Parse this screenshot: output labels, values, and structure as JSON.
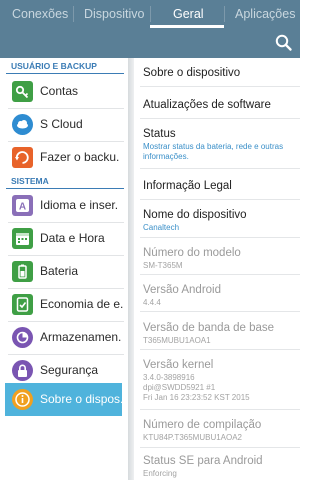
{
  "tabs": [
    "Conexões",
    "Dispositivo",
    "Geral",
    "Aplicações"
  ],
  "active_tab": "Geral",
  "sidebar": {
    "sections": [
      {
        "title": "USUÁRIO E BACKUP",
        "items": [
          {
            "label": "Contas",
            "icon": "key-icon",
            "color": "#3f9f45"
          },
          {
            "label": "S Cloud",
            "icon": "cloud-icon",
            "color": "#2e8cd1"
          },
          {
            "label": "Fazer o backu.",
            "icon": "backup-icon",
            "color": "#e8632a"
          }
        ]
      },
      {
        "title": "SISTEMA",
        "items": [
          {
            "label": "Idioma e inser.",
            "icon": "language-icon",
            "color": "#8a6fb8"
          },
          {
            "label": "Data e Hora",
            "icon": "calendar-icon",
            "color": "#3f9f45"
          },
          {
            "label": "Bateria",
            "icon": "battery-icon",
            "color": "#3f9f45"
          },
          {
            "label": "Economia de e.",
            "icon": "power-saving-icon",
            "color": "#3f9f45"
          },
          {
            "label": "Armazenamen.",
            "icon": "storage-icon",
            "color": "#7a55b2"
          },
          {
            "label": "Segurança",
            "icon": "lock-icon",
            "color": "#7a55b2"
          },
          {
            "label": "Sobre o dispos.",
            "icon": "info-icon",
            "color": "#f0a020",
            "selected": true
          }
        ]
      }
    ]
  },
  "panel": {
    "items": [
      {
        "title": "Sobre o dispositivo"
      },
      {
        "title": "Atualizações de software"
      },
      {
        "title": "Status",
        "subtitle": "Mostrar status da bateria, rede e outras informações."
      },
      {
        "title": "Informação Legal"
      },
      {
        "title": "Nome do dispositivo",
        "subtitle": "Canaltech"
      },
      {
        "title": "Número do modelo",
        "subtitle": "SM-T365M",
        "dim": true
      },
      {
        "title": "Versão Android",
        "subtitle": "4.4.4",
        "dim": true
      },
      {
        "title": "Versão de banda de base",
        "subtitle": "T365MUBU1AOA1",
        "dim": true
      },
      {
        "title": "Versão kernel",
        "subtitle": "3.4.0-3898916\ndpi@SWDD5921 #1\nFri Jan 16 23:23:52 KST 2015",
        "dim": true
      },
      {
        "title": "Número de compilação",
        "subtitle": "KTU84P.T365MUBU1AOA2",
        "dim": true
      },
      {
        "title": "Status SE para Android",
        "subtitle": "Enforcing",
        "dim": true
      }
    ]
  }
}
